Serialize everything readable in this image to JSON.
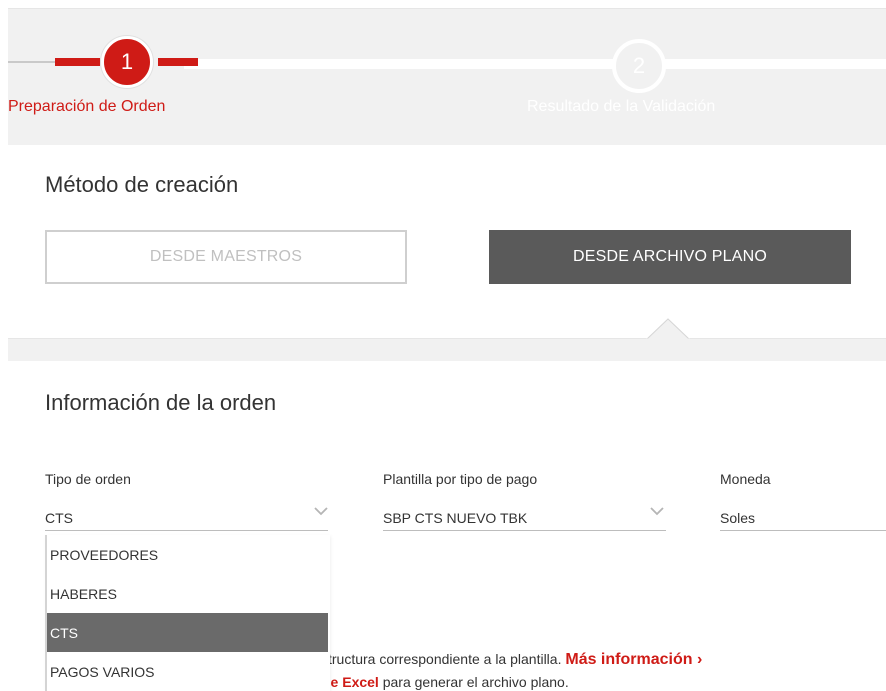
{
  "stepper": {
    "steps": [
      {
        "number": "1",
        "label": "Preparación de Orden",
        "active": true
      },
      {
        "number": "2",
        "label": "Resultado de la Validación",
        "active": false
      }
    ]
  },
  "method": {
    "title": "Método de creación",
    "option_maestros": "DESDE MAESTROS",
    "option_archivo": "DESDE ARCHIVO PLANO",
    "selected": "DESDE ARCHIVO PLANO"
  },
  "order": {
    "title": "Información de la orden",
    "tipo_label": "Tipo de orden",
    "tipo_value": "CTS",
    "plantilla_label": "Plantilla por tipo de pago",
    "plantilla_value": "SBP CTS NUEVO TBK",
    "moneda_label": "Moneda",
    "moneda_value": "Soles",
    "tipo_options": [
      {
        "label": "PROVEEDORES",
        "selected": false
      },
      {
        "label": "HABERES",
        "selected": false
      },
      {
        "label": "CTS",
        "selected": true
      },
      {
        "label": "PAGOS VARIOS",
        "selected": false
      }
    ]
  },
  "info": {
    "line1_text": "tructura correspondiente a la plantilla.",
    "line1_link": "Más información ›",
    "line2_bold": "de Excel",
    "line2_text": "para generar el archivo plano."
  },
  "colors": {
    "accent": "#cf1b16",
    "button_dark": "#5a5a5a",
    "band": "#f1f1f1"
  }
}
